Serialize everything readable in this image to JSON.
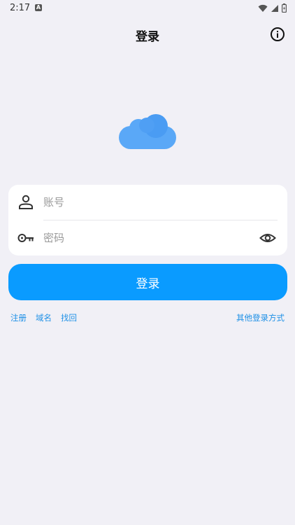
{
  "status_bar": {
    "time": "2:17",
    "notification_badge": "A"
  },
  "header": {
    "title": "登录"
  },
  "form": {
    "account_placeholder": "账号",
    "password_placeholder": "密码"
  },
  "login_button": {
    "label": "登录"
  },
  "links": {
    "register": "注册",
    "domain": "域名",
    "recover": "找回",
    "other_login": "其他登录方式"
  },
  "colors": {
    "background": "#f1f0f6",
    "accent": "#0a9bff",
    "link": "#1e90e6",
    "card": "#ffffff"
  },
  "icons": [
    "wifi-icon",
    "signal-icon",
    "battery-icon",
    "info-icon",
    "cloud-logo",
    "user-icon",
    "key-icon",
    "eye-icon"
  ]
}
